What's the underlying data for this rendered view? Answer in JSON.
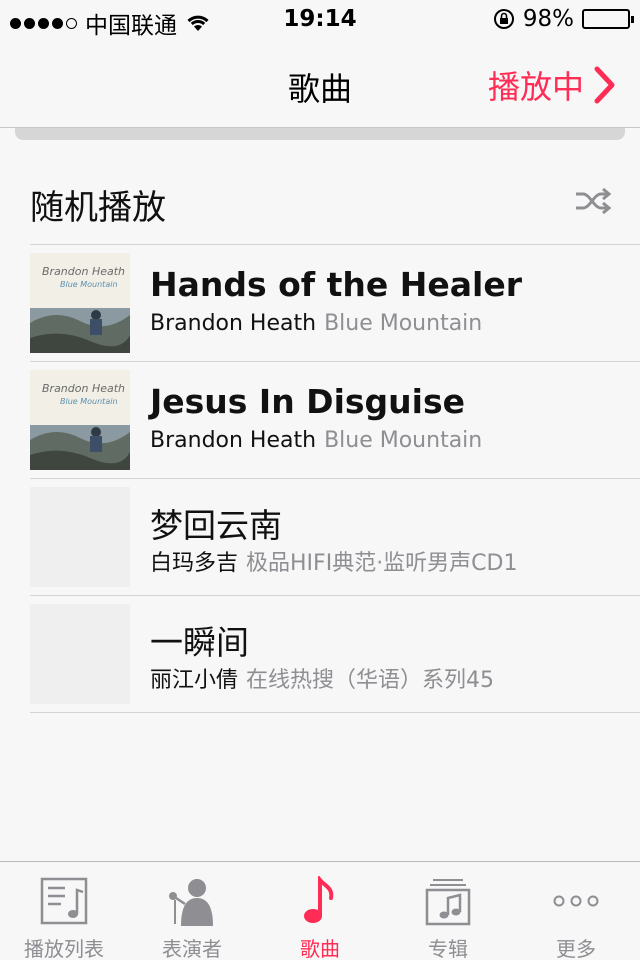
{
  "status": {
    "carrier": "中国联通",
    "time": "19:14",
    "battery": "98%",
    "battery_level": 0.98
  },
  "nav": {
    "title": "歌曲",
    "now_playing": "播放中"
  },
  "shuffle": {
    "label": "随机播放",
    "icon": "shuffle-icon"
  },
  "songs": [
    {
      "title": "Hands of the Healer",
      "artist": "Brandon Heath",
      "album": "Blue Mountain",
      "has_art": true
    },
    {
      "title": "Jesus In Disguise",
      "artist": "Brandon Heath",
      "album": "Blue Mountain",
      "has_art": true
    },
    {
      "title": "梦回云南",
      "artist": "白玛多吉",
      "album": "极品HIFI典范·监听男声CD1",
      "has_art": false
    },
    {
      "title": "一瞬间",
      "artist": "丽江小倩",
      "album": "在线热搜（华语）系列45",
      "has_art": false
    }
  ],
  "tabs": [
    {
      "label": "播放列表",
      "icon": "playlist-icon",
      "active": false
    },
    {
      "label": "表演者",
      "icon": "artist-icon",
      "active": false
    },
    {
      "label": "歌曲",
      "icon": "music-note-icon",
      "active": true
    },
    {
      "label": "专辑",
      "icon": "album-icon",
      "active": false
    },
    {
      "label": "更多",
      "icon": "more-icon",
      "active": false
    }
  ],
  "colors": {
    "accent": "#ff2d55",
    "secondary_text": "#8e8e93",
    "background": "#f7f7f7"
  }
}
